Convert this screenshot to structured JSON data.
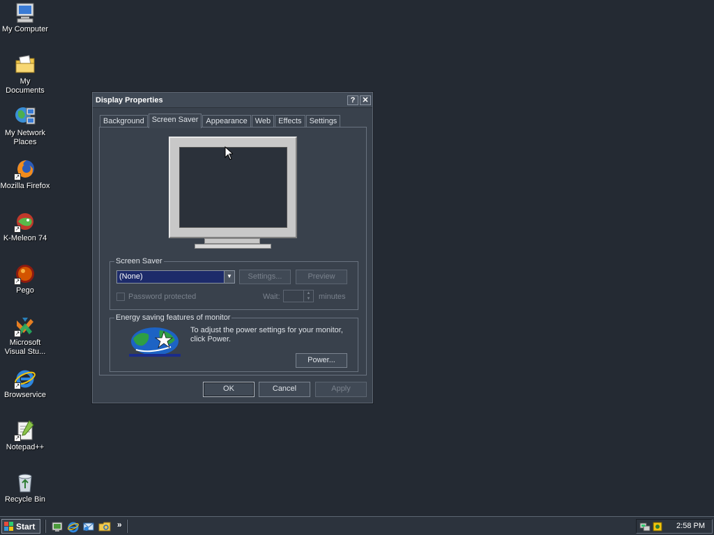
{
  "desktop": {
    "icons": [
      {
        "label": "My Computer",
        "icon": "computer-icon"
      },
      {
        "label": "My Documents",
        "icon": "documents-folder-icon"
      },
      {
        "label": "My Network Places",
        "icon": "network-places-icon"
      },
      {
        "label": "Mozilla Firefox",
        "icon": "firefox-icon"
      },
      {
        "label": "K-Meleon 74",
        "icon": "kmeleon-icon"
      },
      {
        "label": "Pego",
        "icon": "pego-icon"
      },
      {
        "label": "Microsoft Visual Stu...",
        "icon": "visual-studio-icon"
      },
      {
        "label": "Browservice",
        "icon": "internet-explorer-icon"
      },
      {
        "label": "Notepad++",
        "icon": "notepadpp-icon"
      },
      {
        "label": "Recycle Bin",
        "icon": "recycle-bin-icon"
      }
    ]
  },
  "dialog": {
    "title": "Display Properties",
    "help_button": "?",
    "close_button": "✕",
    "tabs": [
      {
        "label": "Background",
        "active": false
      },
      {
        "label": "Screen Saver",
        "active": true
      },
      {
        "label": "Appearance",
        "active": false
      },
      {
        "label": "Web",
        "active": false
      },
      {
        "label": "Effects",
        "active": false
      },
      {
        "label": "Settings",
        "active": false
      }
    ],
    "screen_saver": {
      "legend": "Screen Saver",
      "selected": "(None)",
      "settings_label": "Settings...",
      "preview_label": "Preview",
      "password_label": "Password protected",
      "wait_label": "Wait:",
      "wait_value": "",
      "minutes_label": "minutes"
    },
    "energy": {
      "legend": "Energy saving features of monitor",
      "description_line1": "To adjust the power settings for your monitor,",
      "description_line2": "click Power.",
      "power_label": "Power..."
    },
    "buttons": {
      "ok": "OK",
      "cancel": "Cancel",
      "apply": "Apply"
    }
  },
  "taskbar": {
    "start_label": "Start",
    "chevron": "»",
    "clock": "2:58 PM"
  }
}
